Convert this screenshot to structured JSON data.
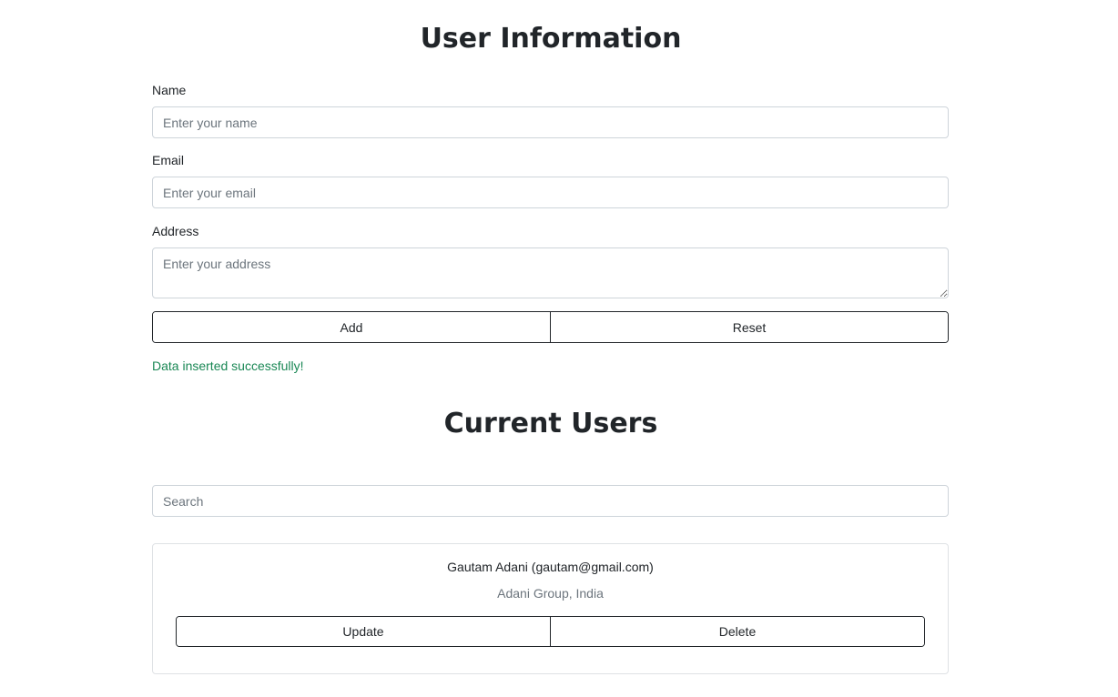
{
  "form": {
    "title": "User Information",
    "name_label": "Name",
    "name_placeholder": "Enter your name",
    "name_value": "",
    "email_label": "Email",
    "email_placeholder": "Enter your email",
    "email_value": "",
    "address_label": "Address",
    "address_placeholder": "Enter your address",
    "address_value": "",
    "add_label": "Add",
    "reset_label": "Reset",
    "success_message": "Data inserted successfully!"
  },
  "users": {
    "title": "Current Users",
    "search_placeholder": "Search",
    "search_value": "",
    "list": [
      {
        "name_email": "Gautam Adani (gautam@gmail.com)",
        "address": "Adani Group, India",
        "update_label": "Update",
        "delete_label": "Delete"
      }
    ]
  },
  "colors": {
    "text": "#212529",
    "muted": "#6c757d",
    "success": "#198754",
    "border": "#ced4da"
  }
}
